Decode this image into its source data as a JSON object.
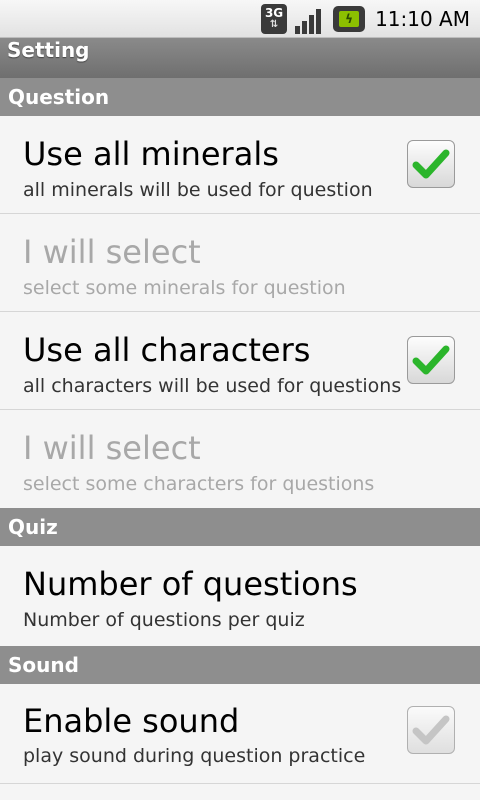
{
  "status_bar": {
    "network": "3G",
    "network_arrows": "⇅",
    "battery_glyph": "ϟ",
    "time": "11:10 AM"
  },
  "title": "Setting",
  "sections": {
    "question": "Question",
    "quiz": "Quiz",
    "sound": "Sound"
  },
  "prefs": {
    "use_all_minerals": {
      "title": "Use all minerals",
      "summary": "all minerals will be used for question",
      "checked": true
    },
    "select_minerals": {
      "title": "I will select",
      "summary": "select some minerals for question"
    },
    "use_all_characters": {
      "title": "Use all characters",
      "summary": "all characters will be used for questions",
      "checked": true
    },
    "select_characters": {
      "title": "I will select",
      "summary": "select some characters for questions"
    },
    "num_questions": {
      "title": "Number of questions",
      "summary": "Number of questions per quiz"
    },
    "enable_sound": {
      "title": "Enable sound",
      "summary": "play sound during question practice",
      "checked": true
    }
  },
  "colors": {
    "check_green": "#2bb52b",
    "check_gray": "#b5b5b5"
  }
}
